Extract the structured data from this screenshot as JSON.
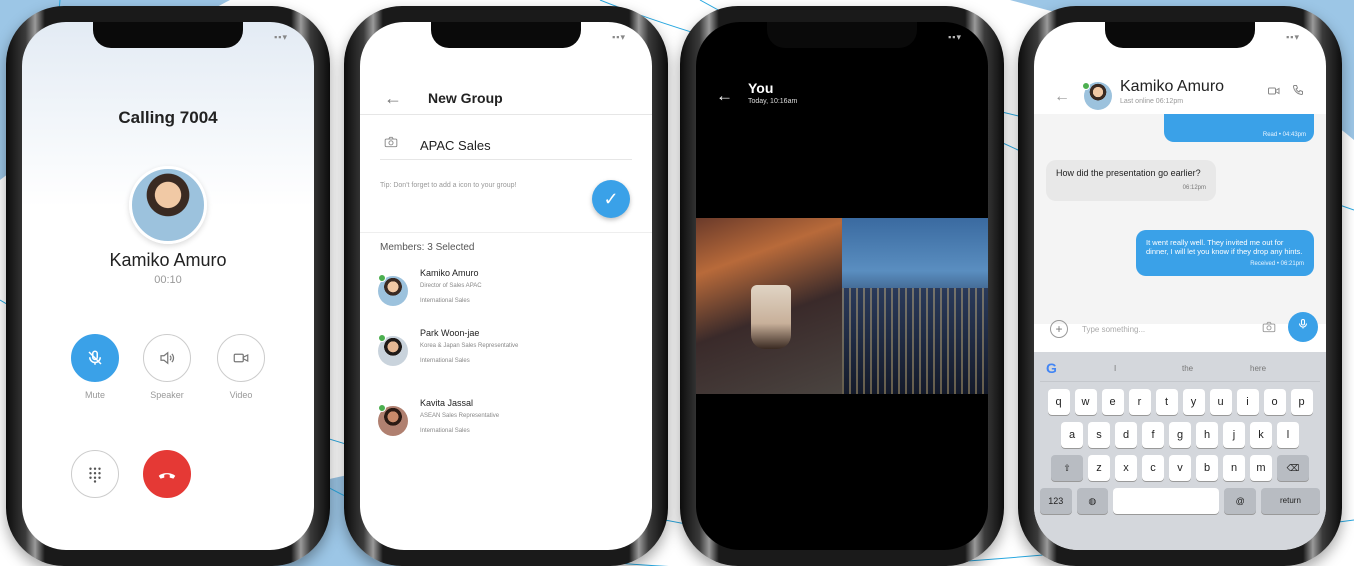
{
  "phone1": {
    "status_icons": "▪▪▾",
    "title": "Calling 7004",
    "caller_name": "Kamiko Amuro",
    "timer": "00:10",
    "controls": [
      {
        "label": "Mute",
        "icon": "mic-off-icon"
      },
      {
        "label": "Speaker",
        "icon": "speaker-icon"
      },
      {
        "label": "Video",
        "icon": "video-icon"
      }
    ],
    "icons": {
      "keypad": "keypad-icon",
      "end_call": "end-call-icon"
    }
  },
  "phone2": {
    "status_icons": "▪▪▾",
    "title": "New Group",
    "group_name": "APAC Sales",
    "tip": "Tip: Don't forget to add a icon to your group!",
    "members_label": "Members: 3 Selected",
    "members": [
      {
        "name": "Kamiko Amuro",
        "role": "Director of Sales APAC",
        "team": "International Sales",
        "online": true
      },
      {
        "name": "Park Woon-jae",
        "role": "Korea & Japan Sales Representative",
        "team": "International Sales",
        "online": true
      },
      {
        "name": "Kavita Jassal",
        "role": "ASEAN Sales Representative",
        "team": "International Sales",
        "online": true
      }
    ]
  },
  "phone3": {
    "status_icons": "▪▪▾",
    "title": "You",
    "subtitle": "Today, 10:16am"
  },
  "phone4": {
    "status_icons": "▪▪▾",
    "contact_name": "Kamiko Amuro",
    "last_online": "Last online 06:12pm",
    "messages": [
      {
        "direction": "sent",
        "text": "",
        "status": "Read • 04:43pm"
      },
      {
        "direction": "received",
        "text": "How did the presentation go earlier?",
        "time": "06:12pm"
      },
      {
        "direction": "sent",
        "text": "It went really well. They invited me out for dinner, I will let you know if they drop any hints.",
        "status": "Received • 06:21pm"
      }
    ],
    "composer_placeholder": "Type something...",
    "keyboard": {
      "suggestions": [
        "I",
        "the",
        "here"
      ],
      "row1": [
        "q",
        "w",
        "e",
        "r",
        "t",
        "y",
        "u",
        "i",
        "o",
        "p"
      ],
      "row2": [
        "a",
        "s",
        "d",
        "f",
        "g",
        "h",
        "j",
        "k",
        "l"
      ],
      "row3": [
        "z",
        "x",
        "c",
        "v",
        "b",
        "n",
        "m"
      ],
      "numbers_key": "123",
      "at_key": "@",
      "return_key": "return"
    }
  },
  "colors": {
    "accent": "#3aa1e8",
    "end_call": "#e53935",
    "online": "#4caf50",
    "background_swoosh": "#7fb4dc"
  }
}
